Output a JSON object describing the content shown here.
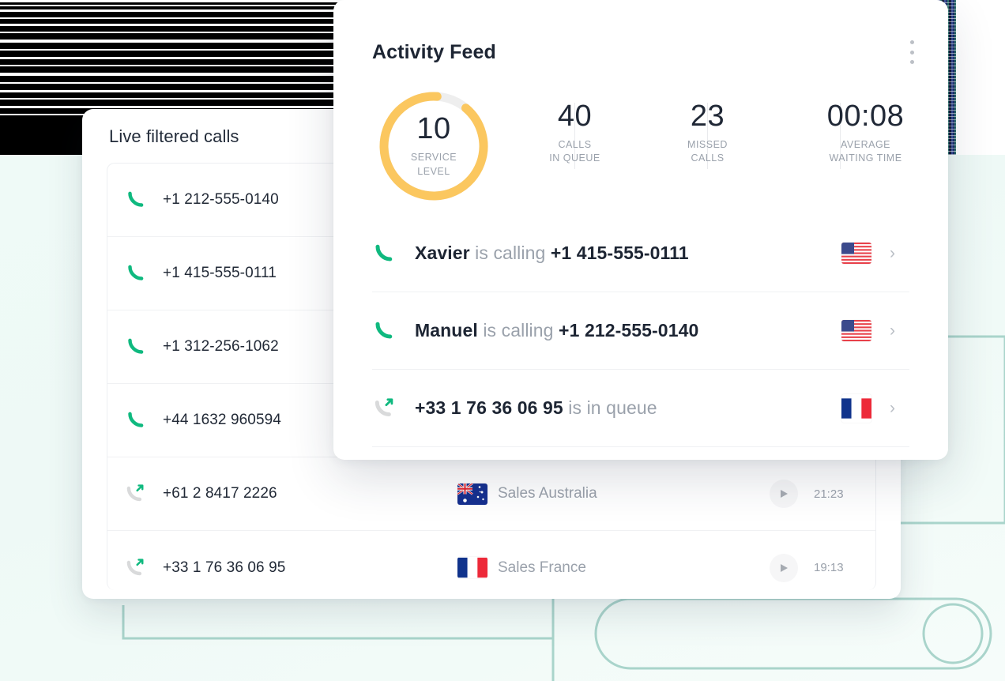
{
  "background": {
    "mint": "#effaf7",
    "deco_stroke": "#a9d4cb",
    "glitch_description": "corrupted dark scanline banner"
  },
  "live_calls_card": {
    "title": "Live filtered calls",
    "rows": [
      {
        "icon": "phone-incoming-icon",
        "number": "+1 212-555-0140",
        "team": "",
        "flag": "",
        "time": ""
      },
      {
        "icon": "phone-incoming-icon",
        "number": "+1 415-555-0111",
        "team": "",
        "flag": "",
        "time": ""
      },
      {
        "icon": "phone-incoming-icon",
        "number": "+1 312-256-1062",
        "team": "",
        "flag": "",
        "time": ""
      },
      {
        "icon": "phone-incoming-icon",
        "number": "+44 1632 960594",
        "team": "",
        "flag": "",
        "time": ""
      },
      {
        "icon": "phone-outgoing-icon",
        "number": "+61 2 8417 2226",
        "team": "Sales Australia",
        "flag": "au",
        "time": "21:23"
      },
      {
        "icon": "phone-outgoing-icon",
        "number": "+33 1 76 36 06 95",
        "team": "Sales France",
        "flag": "fr",
        "time": "19:13"
      }
    ]
  },
  "activity_feed": {
    "title": "Activity Feed",
    "menu_icon": "kebab-menu-icon",
    "stats": {
      "service_level": {
        "value": "10",
        "caption_line1": "SERVICE",
        "caption_line2": "LEVEL",
        "arc_percent": 90,
        "arc_color": "#fbc75f",
        "track_color": "#eeeeee"
      },
      "items": [
        {
          "value": "40",
          "caption_line1": "CALLS",
          "caption_line2": "IN QUEUE"
        },
        {
          "value": "23",
          "caption_line1": "MISSED",
          "caption_line2": "CALLS"
        },
        {
          "value": "00:08",
          "caption_line1": "AVERAGE",
          "caption_line2": "WAITING TIME"
        }
      ]
    },
    "rows": [
      {
        "icon": "phone-incoming-icon",
        "name": "Xavier",
        "action": " is calling ",
        "number": "+1 415-555-0111",
        "flag": "us",
        "chevron": "›"
      },
      {
        "icon": "phone-incoming-icon",
        "name": "Manuel",
        "action": " is calling ",
        "number": "+1 212-555-0140",
        "flag": "us",
        "chevron": "›"
      },
      {
        "icon": "phone-outgoing-icon",
        "name": "",
        "action": " is in queue",
        "number": "+33 1 76 36 06 95",
        "flag": "fr",
        "chevron": "›"
      }
    ]
  },
  "colors": {
    "phone_green": "#0fb97f",
    "phone_gray": "#d9dadb",
    "amber": "#fbc75f",
    "text_dark": "#1d2533",
    "text_muted": "#9aa1ab"
  }
}
